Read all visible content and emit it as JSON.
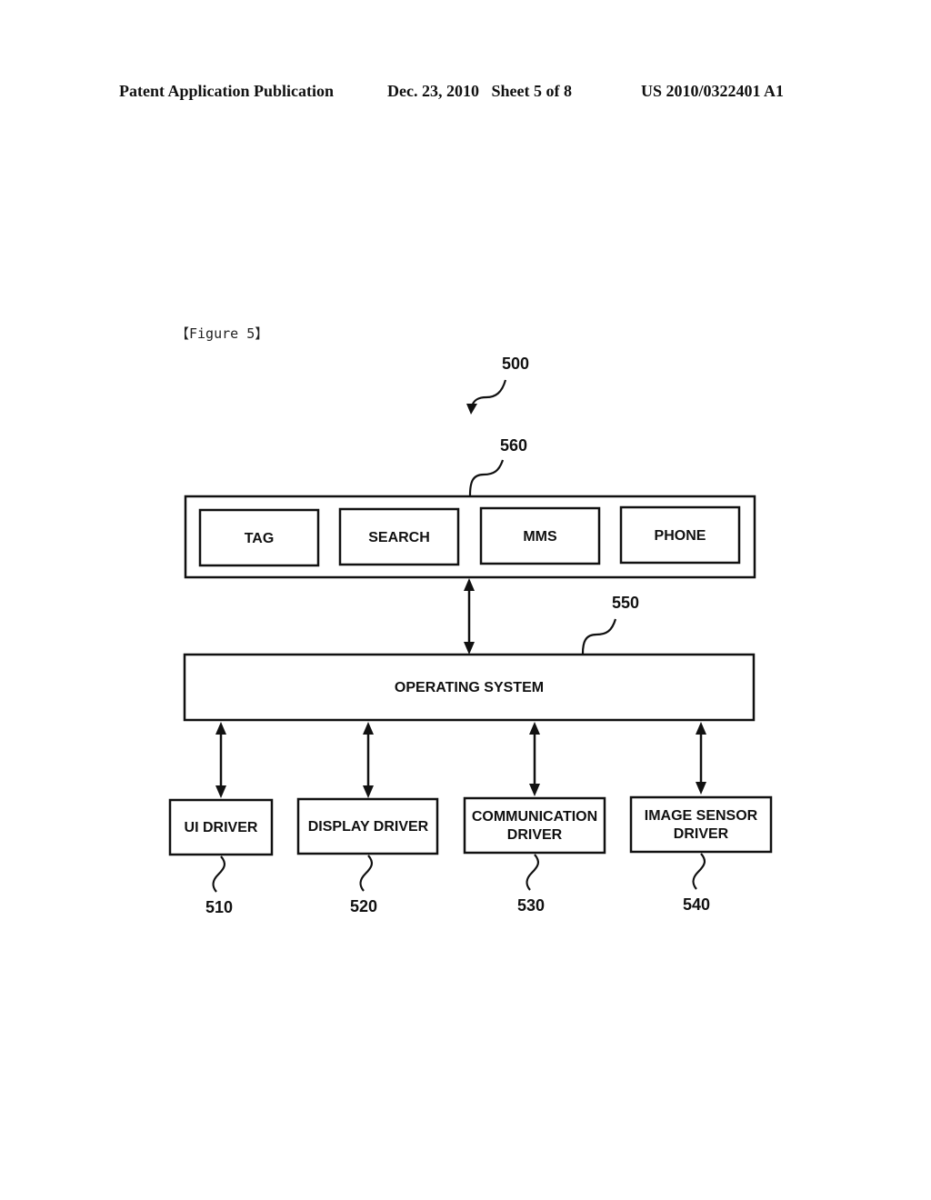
{
  "header": {
    "publication": "Patent Application Publication",
    "date_sheet": "Dec. 23, 2010   Sheet 5 of 8",
    "number": "US 2010/0322401 A1"
  },
  "figure": {
    "label": "【Figure 5】",
    "system_ref": "500",
    "app_layer": {
      "ref": "560",
      "apps": [
        "TAG",
        "SEARCH",
        "MMS",
        "PHONE"
      ]
    },
    "os": {
      "ref": "550",
      "label": "OPERATING SYSTEM"
    },
    "drivers": [
      {
        "ref": "510",
        "lines": [
          "UI DRIVER"
        ]
      },
      {
        "ref": "520",
        "lines": [
          "DISPLAY DRIVER"
        ]
      },
      {
        "ref": "530",
        "lines": [
          "COMMUNICATION",
          "DRIVER"
        ]
      },
      {
        "ref": "540",
        "lines": [
          "IMAGE SENSOR",
          "DRIVER"
        ]
      }
    ]
  }
}
